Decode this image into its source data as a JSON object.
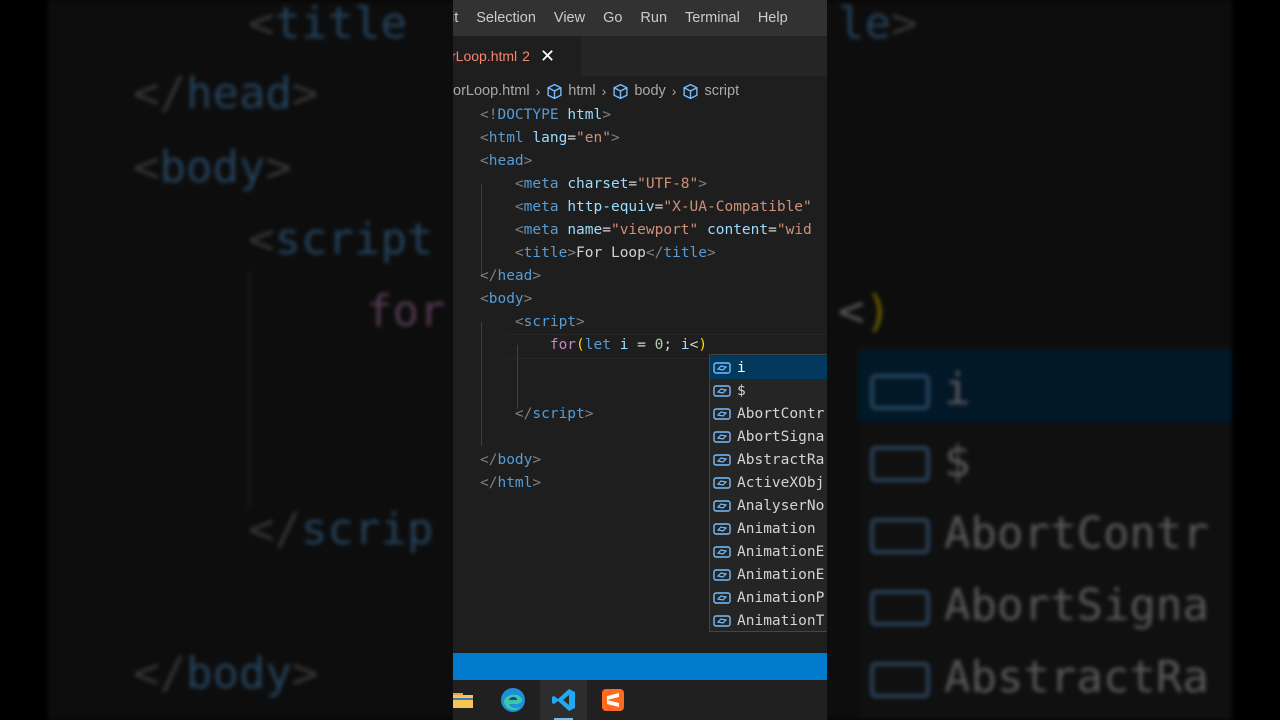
{
  "background": {
    "lines": [
      {
        "text": "<title>",
        "style": "tag"
      },
      {
        "text": "</head>",
        "style": "tag"
      },
      {
        "text": "<body>",
        "style": "tag"
      },
      {
        "text": "<script",
        "style": "tag"
      },
      {
        "text": "for",
        "style": "kw"
      },
      {
        "text": "</scrip",
        "style": "tag"
      },
      {
        "text": "</body>",
        "style": "tag"
      },
      {
        "text": "le>",
        "style": "tag"
      },
      {
        "text": "<)",
        "style": "paren"
      }
    ],
    "suggestions": [
      "i",
      "$",
      "AbortContr",
      "AbortSigna",
      "AbstractRa"
    ]
  },
  "menubar": {
    "items": [
      "it",
      "Selection",
      "View",
      "Go",
      "Run",
      "Terminal",
      "Help"
    ]
  },
  "tab": {
    "filename": "rLoop.html",
    "problems": "2",
    "close": "✕"
  },
  "breadcrumb": {
    "file": "orLoop.html",
    "items": [
      "html",
      "body",
      "script"
    ]
  },
  "editor": {
    "lines": [
      [
        [
          "br",
          "<!"
        ],
        [
          "tag",
          "DOCTYPE"
        ],
        [
          "txt",
          " "
        ],
        [
          "attr",
          "html"
        ],
        [
          "br",
          ">"
        ]
      ],
      [
        [
          "br",
          "<"
        ],
        [
          "tag",
          "html"
        ],
        [
          "txt",
          " "
        ],
        [
          "attr",
          "lang"
        ],
        [
          "txt",
          "="
        ],
        [
          "str",
          "\"en\""
        ],
        [
          "br",
          ">"
        ]
      ],
      [
        [
          "br",
          "<"
        ],
        [
          "tag",
          "head"
        ],
        [
          "br",
          ">"
        ]
      ],
      [
        [
          "txt",
          "    "
        ],
        [
          "br",
          "<"
        ],
        [
          "tag",
          "meta"
        ],
        [
          "txt",
          " "
        ],
        [
          "attr",
          "charset"
        ],
        [
          "txt",
          "="
        ],
        [
          "str",
          "\"UTF-8\""
        ],
        [
          "br",
          ">"
        ]
      ],
      [
        [
          "txt",
          "    "
        ],
        [
          "br",
          "<"
        ],
        [
          "tag",
          "meta"
        ],
        [
          "txt",
          " "
        ],
        [
          "attr",
          "http-equiv"
        ],
        [
          "txt",
          "="
        ],
        [
          "str",
          "\"X-UA-Compatible\""
        ]
      ],
      [
        [
          "txt",
          "    "
        ],
        [
          "br",
          "<"
        ],
        [
          "tag",
          "meta"
        ],
        [
          "txt",
          " "
        ],
        [
          "attr",
          "name"
        ],
        [
          "txt",
          "="
        ],
        [
          "str",
          "\"viewport\""
        ],
        [
          "txt",
          " "
        ],
        [
          "attr",
          "content"
        ],
        [
          "txt",
          "="
        ],
        [
          "str",
          "\"wid"
        ]
      ],
      [
        [
          "txt",
          "    "
        ],
        [
          "br",
          "<"
        ],
        [
          "tag",
          "title"
        ],
        [
          "br",
          ">"
        ],
        [
          "txt",
          "For Loop"
        ],
        [
          "br",
          "</"
        ],
        [
          "tag",
          "title"
        ],
        [
          "br",
          ">"
        ]
      ],
      [
        [
          "br",
          "</"
        ],
        [
          "tag",
          "head"
        ],
        [
          "br",
          ">"
        ]
      ],
      [
        [
          "br",
          "<"
        ],
        [
          "tag",
          "body"
        ],
        [
          "br",
          ">"
        ]
      ],
      [
        [
          "txt",
          "    "
        ],
        [
          "br",
          "<"
        ],
        [
          "tag",
          "script"
        ],
        [
          "br",
          ">"
        ]
      ],
      [
        [
          "txt",
          "        "
        ],
        [
          "kw",
          "for"
        ],
        [
          "paren",
          "("
        ],
        [
          "let",
          "let"
        ],
        [
          "txt",
          " "
        ],
        [
          "var",
          "i"
        ],
        [
          "txt",
          " = "
        ],
        [
          "num",
          "0"
        ],
        [
          "txt",
          "; "
        ],
        [
          "var",
          "i"
        ],
        [
          "txt",
          "<"
        ],
        [
          "paren",
          ")"
        ]
      ],
      [],
      [],
      [
        [
          "txt",
          "    "
        ],
        [
          "br",
          "</"
        ],
        [
          "tag",
          "script"
        ],
        [
          "br",
          ">"
        ]
      ],
      [],
      [
        [
          "br",
          "</"
        ],
        [
          "tag",
          "body"
        ],
        [
          "br",
          ">"
        ]
      ],
      [
        [
          "br",
          "</"
        ],
        [
          "tag",
          "html"
        ],
        [
          "br",
          ">"
        ]
      ]
    ]
  },
  "suggestions": {
    "items": [
      "i",
      "$",
      "AbortContr",
      "AbortSigna",
      "AbstractRa",
      "ActiveXObj",
      "AnalyserNo",
      "Animation",
      "AnimationE",
      "AnimationE",
      "AnimationP",
      "AnimationT"
    ],
    "selected_index": 0,
    "icon": "variable-icon"
  },
  "taskbar": {
    "apps": [
      {
        "name": "file-explorer-icon"
      },
      {
        "name": "edge-icon"
      },
      {
        "name": "vscode-icon",
        "active": true
      },
      {
        "name": "sublime-text-icon"
      }
    ]
  },
  "colors": {
    "accent": "#007acc",
    "editor_bg": "#1e1e1e",
    "tag": "#569cd6",
    "attr": "#9cdcfe",
    "string": "#ce9178",
    "keyword": "#c586c0",
    "tab_error": "#f48771",
    "suggest_selected": "#04395e"
  }
}
